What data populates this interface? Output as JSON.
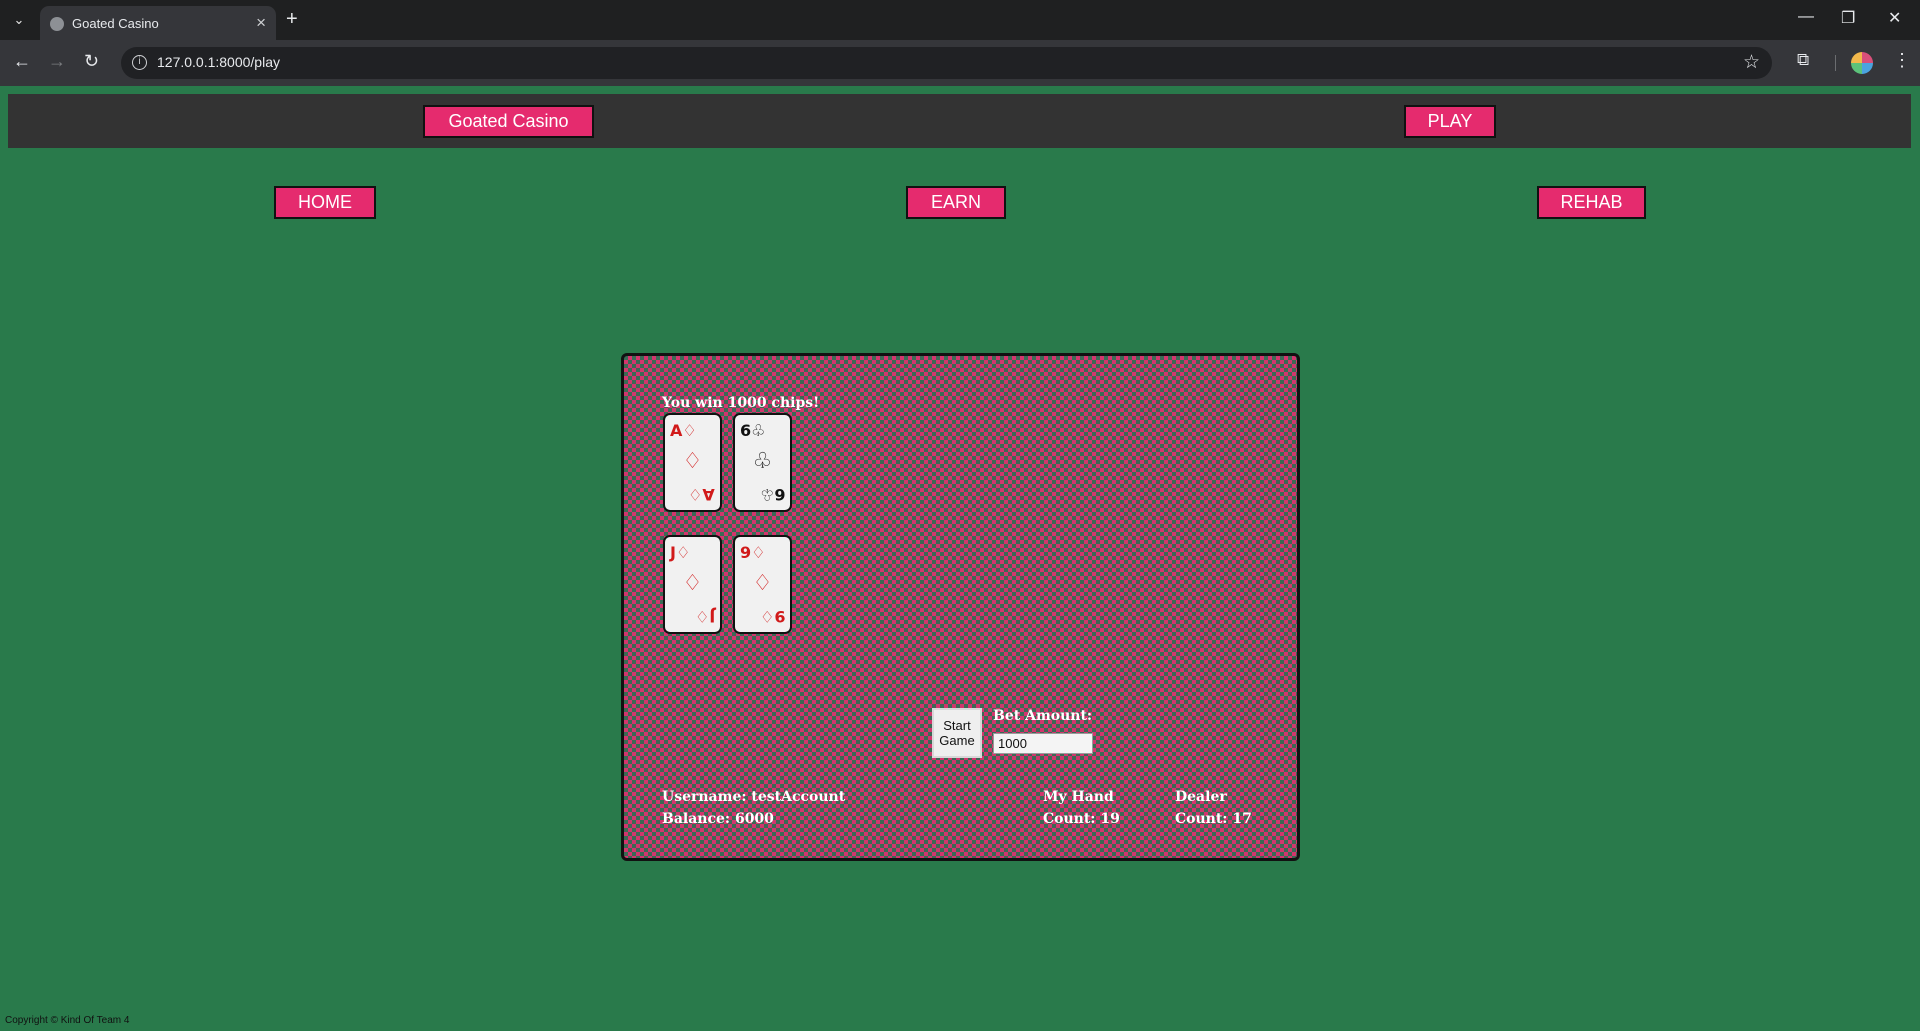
{
  "browser": {
    "tab_title": "Goated Casino",
    "url": "127.0.0.1:8000/play",
    "tab_menu_icon": "chevron-down-icon",
    "new_tab_icon": "plus-icon"
  },
  "header": {
    "brand": "Goated Casino",
    "play": "PLAY"
  },
  "nav": {
    "home": "HOME",
    "earn": "EARN",
    "rehab": "REHAB"
  },
  "game": {
    "result_message": "You win 1000 chips!",
    "player_cards": [
      {
        "rank": "A",
        "suit": "♢",
        "color": "red"
      },
      {
        "rank": "6",
        "suit": "♧",
        "color": "black"
      }
    ],
    "dealer_cards": [
      {
        "rank": "J",
        "suit": "♢",
        "color": "red"
      },
      {
        "rank": "9",
        "suit": "♢",
        "color": "red"
      }
    ],
    "start_button": "Start Game",
    "bet_label": "Bet Amount:",
    "bet_value": "1000",
    "username_line": "Username: testAccount",
    "balance_line": "Balance: 6000",
    "my_hand_label": "My Hand",
    "my_hand_count": "Count: 19",
    "dealer_label": "Dealer",
    "dealer_count": "Count: 17"
  },
  "footer": {
    "copyright": "Copyright © Kind Of Team 4"
  },
  "colors": {
    "page_bg": "#297a4b",
    "header_bg": "#333333",
    "accent_pink": "#e52b6e",
    "table_pattern": "#d3356d"
  }
}
